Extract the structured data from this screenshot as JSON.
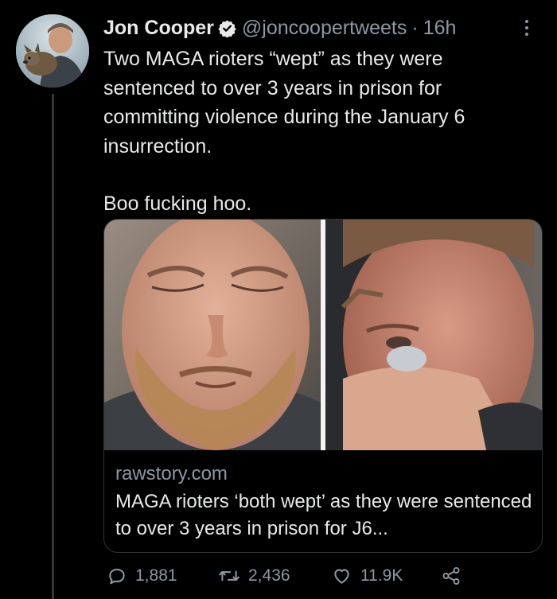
{
  "user": {
    "display_name": "Jon Cooper",
    "handle": "@joncoopertweets",
    "separator": "·",
    "time": "16h",
    "verified": true
  },
  "tweet": {
    "paragraph_1": "Two MAGA rioters “wept” as they were sentenced to over 3 years in prison for committing violence during the January 6 insurrection.",
    "paragraph_2": "Boo fucking hoo."
  },
  "card": {
    "domain": "rawstory.com",
    "title": "MAGA rioters ‘both wept’ as they were sentenced to over 3 years in prison for J6..."
  },
  "actions": {
    "replies": "1,881",
    "retweets": "2,436",
    "likes": "11.9K"
  },
  "icons": {
    "verified": "verified-badge-icon",
    "more": "more-icon",
    "reply": "reply-icon",
    "retweet": "retweet-icon",
    "like": "like-icon",
    "share": "share-icon"
  },
  "colors": {
    "background": "#000000",
    "text_primary": "#e7e9ea",
    "text_secondary": "#8b98a5",
    "border": "#2f3336"
  }
}
